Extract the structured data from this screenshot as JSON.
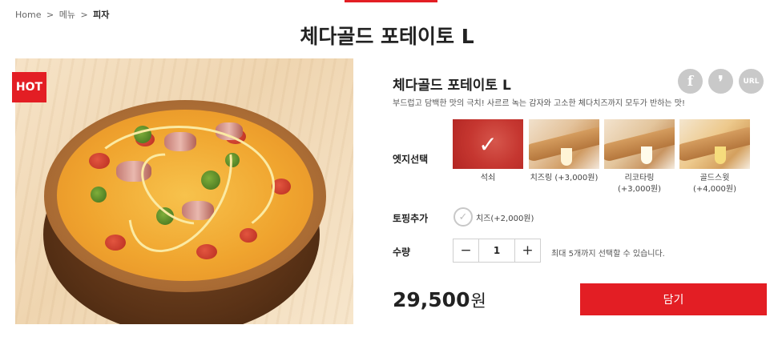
{
  "breadcrumb": {
    "home": "Home",
    "separator": ">",
    "menu": "메뉴",
    "current": "피자"
  },
  "page_title": "체다골드 포테이토 L",
  "product": {
    "badge": "HOT",
    "name": "체다골드 포테이토 L",
    "description": "부드럽고 담백한 맛의 극치! 사르르 녹는 감자와 고소한 체다치즈까지 모두가 반하는 맛!"
  },
  "share": {
    "facebook": "f",
    "kakaostory": "❜",
    "url": "URL"
  },
  "edge": {
    "label": "엣지선택",
    "options": [
      {
        "name": "석쇠",
        "price": "",
        "selected": true
      },
      {
        "name": "치즈링 (+3,000원)",
        "price": "",
        "selected": false
      },
      {
        "name": "리코타링",
        "price": "(+3,000원)",
        "selected": false
      },
      {
        "name": "골드스윗",
        "price": "(+4,000원)",
        "selected": false
      }
    ]
  },
  "topping": {
    "label": "토핑추가",
    "option": "치즈(+2,000원)"
  },
  "quantity": {
    "label": "수량",
    "minus": "−",
    "value": "1",
    "plus": "+",
    "note": "최대 5개까지 선택할 수 있습니다."
  },
  "price": {
    "amount": "29,500",
    "unit": "원"
  },
  "cart_button": "담기",
  "colors": {
    "accent": "#e31e24",
    "share_icon_bg": "#c9c9c9"
  }
}
